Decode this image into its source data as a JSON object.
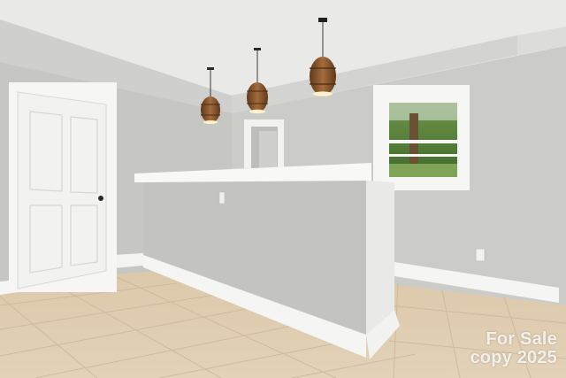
{
  "image": {
    "subject": "empty basement room with kitchenette bar counter and barrel pendant lights",
    "watermark": {
      "line1": "For Sale",
      "line2": "copy 2025"
    }
  },
  "colors": {
    "wall": "#c8c8c6",
    "ceiling": "#e4e4e2",
    "floor_tile": "#ddc9ad",
    "trim": "#f7f7f5",
    "pendant_wood": "#8a5a32"
  }
}
